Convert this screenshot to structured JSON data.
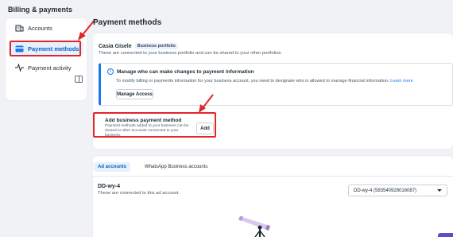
{
  "page_title": "Billing & payments",
  "sidebar": {
    "items": [
      {
        "label": "Accounts",
        "icon": "building-icon"
      },
      {
        "label": "Payment methods",
        "icon": "credit-card-icon",
        "selected": true
      },
      {
        "label": "Payment activity",
        "icon": "activity-icon"
      }
    ]
  },
  "main": {
    "title": "Payment methods",
    "business": {
      "name": "Casia Gisele",
      "badge": "Business portfolio",
      "description": "These are connected to your business portfolio and can be shared to your other portfolios."
    },
    "info": {
      "title": "Manage who can make changes to payment information",
      "text": "To modify billing or payments information for your business account, you need to designate who is allowed to manage financial information.",
      "link": "Learn more",
      "button": "Manage Access"
    },
    "add_payment": {
      "title": "Add business payment method",
      "description": "Payment methods added to your business can be shared to other accounts connected to your business.",
      "button": "Add"
    },
    "tabs": [
      {
        "label": "Ad accounts",
        "active": true
      },
      {
        "label": "WhatsApp Business accounts",
        "active": false
      }
    ],
    "ad_account": {
      "name": "DD-wy-4",
      "description": "These are connected to this ad account.",
      "selected": "DD-wy-4 (583540928016087)"
    }
  },
  "colors": {
    "accent": "#1877f2",
    "highlight": "#e0262b",
    "selected_bg": "#e7f0fd"
  }
}
